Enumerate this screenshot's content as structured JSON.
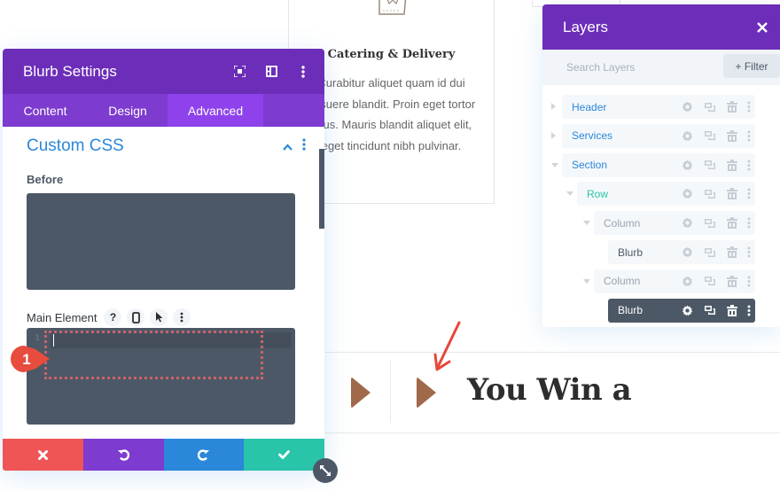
{
  "background": {
    "card": {
      "title": "Catering & Delivery",
      "text": "Curabitur aliquet quam id dui posuere blandit. Proin eget tortor risus. Mauris blandit aliquet elit, eget tincidunt nibh pulvinar.",
      "icon": "shopping-bag-icon"
    },
    "band": {
      "heading": "You Win a",
      "icon": "play-triangle-icon",
      "accent_color": "#a0694a"
    }
  },
  "settings_panel": {
    "title": "Blurb Settings",
    "header_icons": [
      "fullscreen-icon",
      "split-view-icon",
      "more-icon"
    ],
    "tabs": [
      {
        "label": "Content",
        "active": false
      },
      {
        "label": "Design",
        "active": false
      },
      {
        "label": "Advanced",
        "active": true
      }
    ],
    "section": {
      "title": "Custom CSS",
      "expanded": true
    },
    "fields": {
      "before": {
        "label": "Before",
        "value": ""
      },
      "main_element": {
        "label": "Main Element",
        "value": "",
        "line_number": "1",
        "icons": [
          "help-icon",
          "mobile-icon",
          "hover-cursor-icon",
          "more-icon"
        ],
        "help_glyph": "?"
      }
    },
    "footer": {
      "cancel": "close-icon",
      "undo": "undo-icon",
      "redo": "redo-icon",
      "save": "check-icon"
    },
    "colors": {
      "header": "#6c2eb9",
      "tabs": "#7d3bcf",
      "active_tab": "#8f42ec",
      "section_title": "#2b87da",
      "code_bg": "#4c5866",
      "cancel": "#ef5555",
      "undo": "#7e3bd0",
      "redo": "#2b87da",
      "save": "#29c4a9"
    }
  },
  "annotation": {
    "badge_number": "1",
    "badge_color": "#e84c3d",
    "arrow_color": "#e8463a"
  },
  "layers_panel": {
    "title": "Layers",
    "search_placeholder": "Search Layers",
    "filter_label": "+ Filter",
    "items": [
      {
        "label": "Header",
        "type": "section",
        "level": 0,
        "caret": "right",
        "color": "#2b87da",
        "selected": false
      },
      {
        "label": "Services",
        "type": "section",
        "level": 0,
        "caret": "right",
        "color": "#2b87da",
        "selected": false
      },
      {
        "label": "Section",
        "type": "section",
        "level": 0,
        "caret": "down",
        "color": "#2b87da",
        "selected": false
      },
      {
        "label": "Row",
        "type": "row",
        "level": 1,
        "caret": "down",
        "color": "#29c4a9",
        "selected": false
      },
      {
        "label": "Column",
        "type": "column",
        "level": 2,
        "caret": "down",
        "color": "#9aa3ad",
        "selected": false
      },
      {
        "label": "Blurb",
        "type": "module",
        "level": 3,
        "caret": "none",
        "color": "#4c5866",
        "selected": false
      },
      {
        "label": "Column",
        "type": "column",
        "level": 2,
        "caret": "down",
        "color": "#9aa3ad",
        "selected": false
      },
      {
        "label": "Blurb",
        "type": "module",
        "level": 3,
        "caret": "none",
        "color": "#ffffff",
        "selected": true
      }
    ],
    "row_actions": [
      "gear-icon",
      "duplicate-icon",
      "trash-icon",
      "more-icon"
    ]
  }
}
